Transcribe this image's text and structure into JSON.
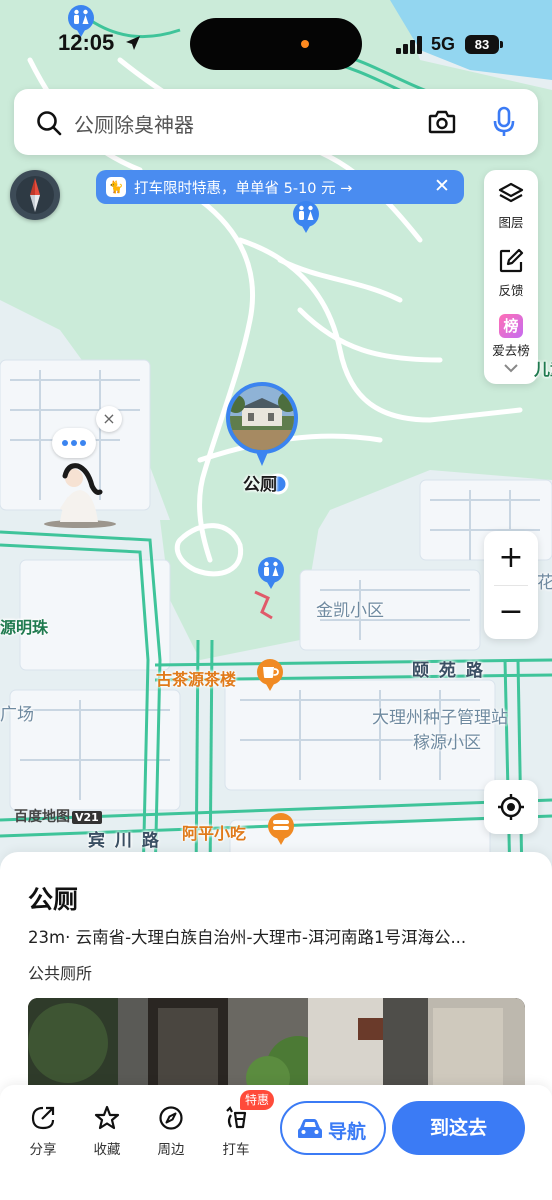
{
  "status_bar": {
    "time": "12:05",
    "network": "5G",
    "battery": "83"
  },
  "search": {
    "query": "公厕除臭神器"
  },
  "promo": {
    "text": "打车限时特惠，单单省 5-10 元 →",
    "logo": "🐈"
  },
  "toolbar": {
    "layers_label": "图层",
    "feedback_label": "反馈",
    "rank_label": "爱去榜",
    "rank_badge": "榜"
  },
  "map": {
    "labels": {
      "jinkai": "金凯小区",
      "yiyuan_road": "颐 苑 路",
      "seed_station": "大理州种子管理站",
      "jiayuan": "稼源小区",
      "tea_house": "古茶源茶楼",
      "aping": "阿平小吃",
      "binchuan_road": "宾 川 路",
      "yuanmingzhu": "源明珠",
      "square": "广场",
      "marker_label": "公厕",
      "right_edge_top": "儿童",
      "right_edge_mid": "花",
      "scale": "百度地图",
      "scale_badge": "V21"
    },
    "icons": {
      "toilet": "toilet-pin-icon",
      "cafe": "cafe-pin-icon",
      "food": "restaurant-pin-icon"
    }
  },
  "place": {
    "title": "公厕",
    "distance": "23m",
    "address": "云南省-大理白族自治州-大理市-洱河南路1号洱海公...",
    "category": "公共厕所"
  },
  "actions": {
    "share": "分享",
    "favorite": "收藏",
    "nearby": "周边",
    "taxi": "打车",
    "taxi_badge": "特惠",
    "navigate": "导航",
    "go_there": "到这去"
  },
  "colors": {
    "accent": "#3b7bf5",
    "road": "#3fc49a",
    "park": "#c9ead8",
    "water": "#8fd3ee"
  }
}
